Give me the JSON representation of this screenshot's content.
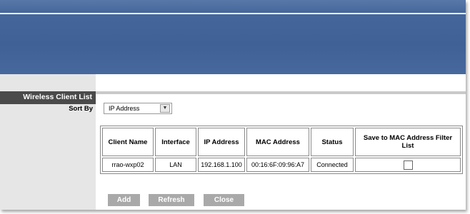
{
  "sidebar": {
    "title": "Wireless Client List",
    "sort_by_label": "Sort By"
  },
  "sort": {
    "selected": "IP Address",
    "arrow_icon": "chevron-down-icon"
  },
  "table": {
    "headers": [
      "Client Name",
      "Interface",
      "IP Address",
      "MAC Address",
      "Status",
      "Save to MAC Address Filter List"
    ],
    "rows": [
      {
        "client_name": "rrao-wxp02",
        "interface": "LAN",
        "ip_address": "192.168.1.100",
        "mac_address": "00:16:6F:09:96:A7",
        "status": "Connected",
        "save_to_filter": false
      }
    ]
  },
  "buttons": {
    "add": "Add",
    "refresh": "Refresh",
    "close": "Close"
  },
  "colors": {
    "banner": "#44669a",
    "sidebar": "#e6e6e6",
    "sidebar_header": "#4a4a4a",
    "button": "#a9a9a9"
  }
}
